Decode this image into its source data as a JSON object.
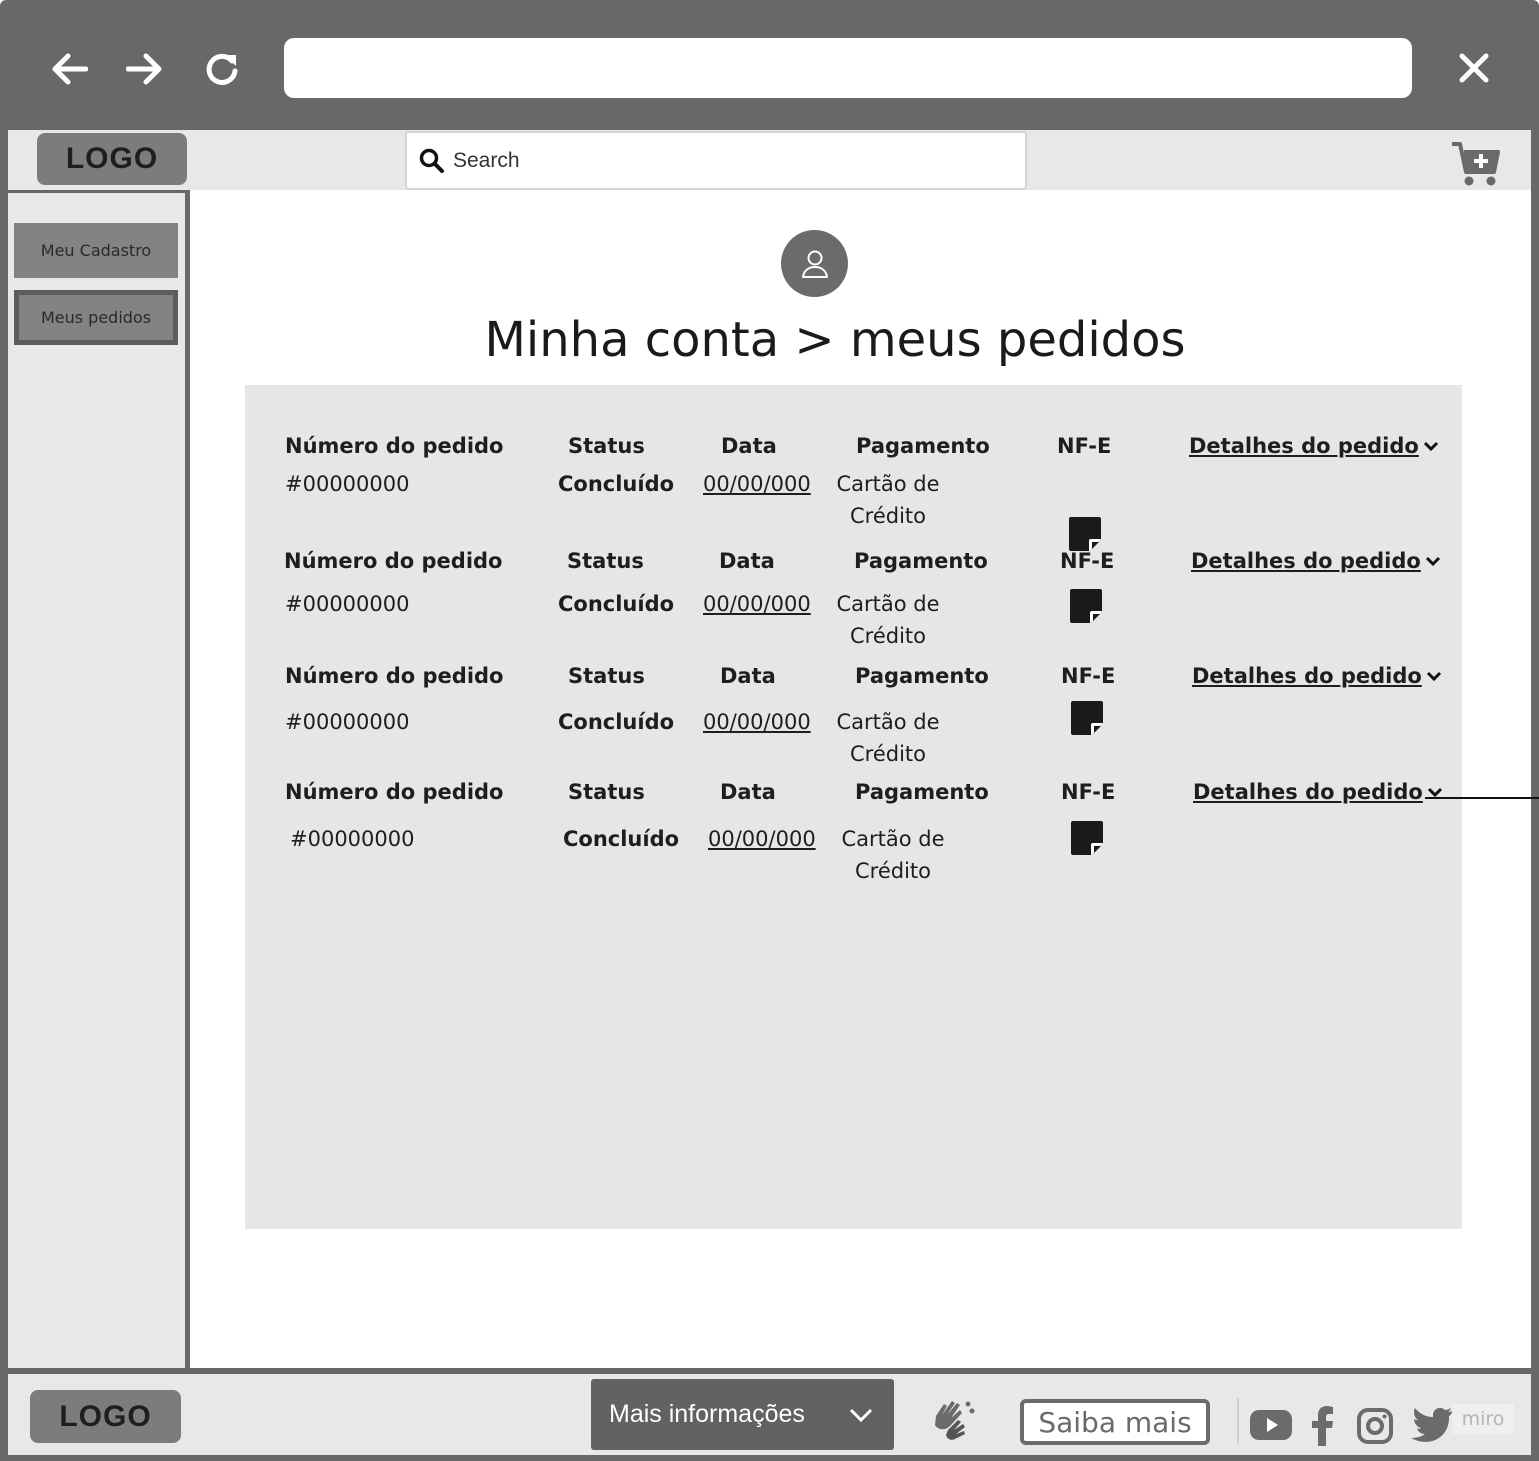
{
  "browser": {
    "back_icon": "arrow-left-icon",
    "forward_icon": "arrow-right-icon",
    "reload_icon": "reload-icon",
    "close_icon": "close-icon",
    "url": ""
  },
  "header": {
    "logo": "LOGO",
    "search_placeholder": "Search",
    "cart_icon": "cart-add-icon"
  },
  "sidebar": {
    "items": [
      {
        "label": "Meu Cadastro",
        "active": false
      },
      {
        "label": "Meus pedidos",
        "active": true
      }
    ]
  },
  "main": {
    "avatar_icon": "user-icon",
    "title": "Minha conta > meus pedidos",
    "orders": [
      {
        "h_number": "Número do pedido",
        "h_status": "Status",
        "h_date": "Data",
        "h_payment": "Pagamento",
        "h_nfe": "NF-E",
        "details": "Detalhes do pedido",
        "number": "#00000000",
        "status": "Concluído",
        "date": "00/00/000",
        "payment": "Cartão de Crédito"
      },
      {
        "h_number": "Número do pedido",
        "h_status": "Status",
        "h_date": "Data",
        "h_payment": "Pagamento",
        "h_nfe": "NF-E",
        "details": "Detalhes do pedido",
        "number": "#00000000",
        "status": "Concluído",
        "date": "00/00/000",
        "payment": "Cartão de Crédito"
      },
      {
        "h_number": "Número do pedido",
        "h_status": "Status",
        "h_date": "Data",
        "h_payment": "Pagamento",
        "h_nfe": "NF-E",
        "details": "Detalhes do pedido",
        "number": "#00000000",
        "status": "Concluído",
        "date": "00/00/000",
        "payment": "Cartão de Crédito"
      },
      {
        "h_number": "Número do pedido",
        "h_status": "Status",
        "h_date": "Data",
        "h_payment": "Pagamento",
        "h_nfe": "NF-E",
        "details": "Detalhes do pedido",
        "number": "#00000000",
        "status": "Concluído",
        "date": "00/00/000",
        "payment": "Cartão de Crédito"
      }
    ]
  },
  "footer": {
    "logo": "LOGO",
    "more_info": "Mais informações",
    "saiba_mais": "Saiba mais",
    "libras_icon": "sign-language-icon",
    "social": [
      "youtube-icon",
      "facebook-icon",
      "instagram-icon",
      "twitter-icon"
    ],
    "watermark": "miro"
  },
  "colors": {
    "chrome": "#686868",
    "panel": "#e6e6e6",
    "bar": "#e8e8e8",
    "sidebar_item": "#838383"
  }
}
